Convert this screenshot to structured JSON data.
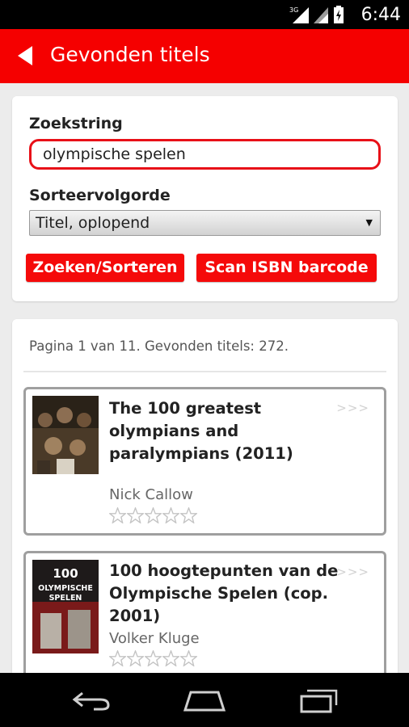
{
  "status_bar": {
    "time": "6:44",
    "network": "3G"
  },
  "app_bar": {
    "title": "Gevonden titels"
  },
  "search": {
    "label": "Zoekstring",
    "value": "olympische spelen",
    "sort_label": "Sorteervolgorde",
    "sort_value": "Titel, oplopend",
    "search_button": "Zoeken/Sorteren",
    "scan_button": "Scan ISBN barcode"
  },
  "results": {
    "pagination": "Pagina 1 van 11. Gevonden titels: 272.",
    "items": [
      {
        "title": "The 100 greatest olympians and paralympians (2011)",
        "author": "Nick Callow",
        "more": ">>>",
        "rating": 0
      },
      {
        "title": "100 hoogtepunten van de Olympische Spelen (cop. 2001)",
        "author": "Volker Kluge",
        "more": ">>>",
        "rating": 0
      }
    ],
    "cover2_text": {
      "number": "100",
      "line1": "OLYMPISCHE",
      "line2": "SPELEN"
    }
  },
  "colors": {
    "accent": "#f50000",
    "input_border": "#e81018",
    "card_border": "#9f9f9f"
  }
}
